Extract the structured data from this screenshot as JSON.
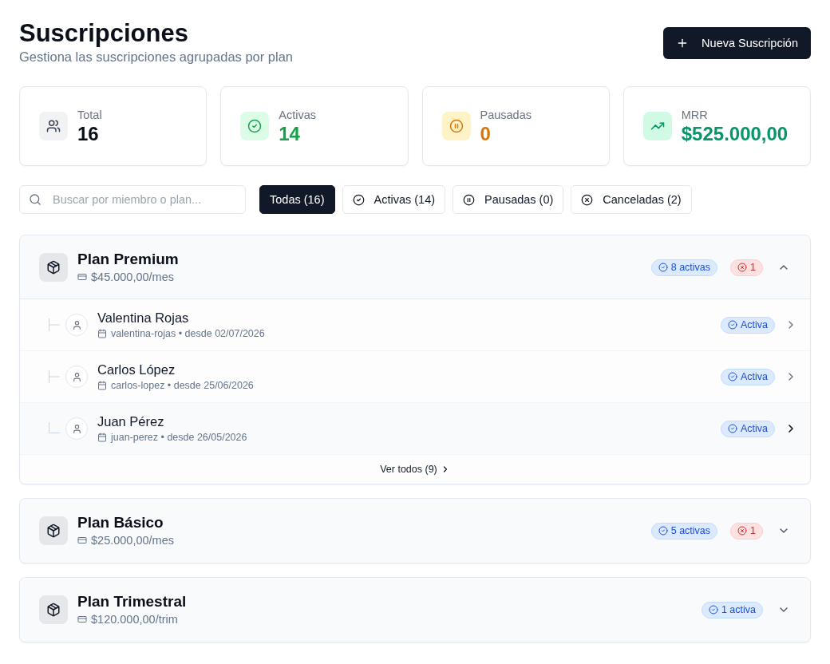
{
  "header": {
    "title": "Suscripciones",
    "subtitle": "Gestiona las suscripciones agrupadas por plan",
    "new_button": {
      "label": "Nueva Suscripción"
    }
  },
  "stats": [
    {
      "kind": "total",
      "label": "Total",
      "value": "16"
    },
    {
      "kind": "active",
      "label": "Activas",
      "value": "14"
    },
    {
      "kind": "paused",
      "label": "Pausadas",
      "value": "0"
    },
    {
      "kind": "revenue",
      "label": "MRR",
      "value": "$525.000,00"
    }
  ],
  "search": {
    "placeholder": "Buscar por miembro o plan..."
  },
  "filters": [
    {
      "kind": "all",
      "label": "Todas (16)",
      "selected": true
    },
    {
      "kind": "active",
      "label": "Activas (14)",
      "selected": false
    },
    {
      "kind": "paused",
      "label": "Pausadas (0)",
      "selected": false
    },
    {
      "kind": "cancelled",
      "label": "Canceladas (2)",
      "selected": false
    }
  ],
  "plans": [
    {
      "name": "Plan Premium",
      "price": "$45.000,00/mes",
      "badges": [
        {
          "kind": "active",
          "label": "8 activas"
        },
        {
          "kind": "cancelled",
          "label": "1"
        }
      ],
      "expanded": true,
      "members": [
        {
          "name": "Valentina Rojas",
          "meta": "valentina-rojas • desde 02/07/2026",
          "status": {
            "kind": "active",
            "label": "Activa"
          },
          "highlighted": false
        },
        {
          "name": "Carlos López",
          "meta": "carlos-lopez • desde 25/06/2026",
          "status": {
            "kind": "active",
            "label": "Activa"
          },
          "highlighted": false
        },
        {
          "name": "Juan Pérez",
          "meta": "juan-perez • desde 26/05/2026",
          "status": {
            "kind": "active",
            "label": "Activa"
          },
          "highlighted": true
        }
      ],
      "view_all": "Ver todos (9)"
    },
    {
      "name": "Plan Básico",
      "price": "$25.000,00/mes",
      "badges": [
        {
          "kind": "active",
          "label": "5 activas"
        },
        {
          "kind": "cancelled",
          "label": "1"
        }
      ],
      "expanded": false
    },
    {
      "name": "Plan Trimestral",
      "price": "$120.000,00/trim",
      "badges": [
        {
          "kind": "active",
          "label": "1 activa"
        }
      ],
      "expanded": false
    }
  ]
}
